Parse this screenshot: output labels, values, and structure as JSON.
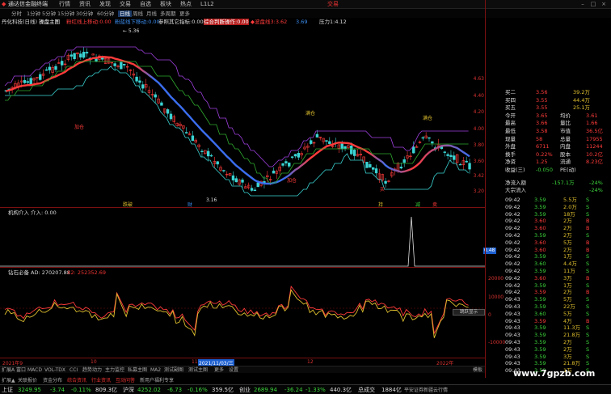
{
  "app": {
    "title": "通达信金融终端",
    "menu": [
      "行情",
      "资讯",
      "发现",
      "交易",
      "自选",
      "板块",
      "热点",
      "L1L2"
    ],
    "trade_label": "交易"
  },
  "tabs": [
    "分时",
    "1分钟",
    "5分钟",
    "15分钟",
    "30分钟",
    "60分钟",
    "日线",
    "周线",
    "月线",
    "多周期",
    "更多"
  ],
  "stock": {
    "name": "丹化科技(日线)"
  },
  "main_indicators": [
    "操盘主图",
    "粉红线上移动:0.00",
    "粉蓝线下移动:0.00",
    "参照其它指标:0.00",
    "综合判断操作:0.00",
    "◆波盘线3:3.62",
    "3.69",
    "压力1:4.12"
  ],
  "price_scale": [
    "4.63",
    "4.40",
    "4.20",
    "4.00",
    "3.80",
    "3.60",
    "3.42",
    "3.20"
  ],
  "annotations": {
    "high": "5.36",
    "low": "3.16",
    "buy": "加仓",
    "buy2": "买",
    "sell": "卖",
    "mark1": "满仓",
    "mark2": "加仓",
    "bottom_labels": [
      "跌破",
      "财",
      "持",
      "减",
      "卖"
    ]
  },
  "sub1": {
    "title": "机构介入",
    "value": "介入: 0.00",
    "scale_val": "0.48"
  },
  "sub2": {
    "title": "钻石必备",
    "ad": "AD: 270207.88",
    "x2": "X2: 252352.69",
    "scale": [
      "20000",
      "10000",
      "0",
      "-10000"
    ],
    "popup": "跳跃显示"
  },
  "xaxis": [
    "2021年9",
    "10",
    "11",
    "2021/11/03/三",
    "12",
    "2022年"
  ],
  "bottom_tabs": [
    "扩展A",
    "富口",
    "MACD",
    "VOL-TDX",
    "CCI",
    "趋势动力",
    "主力监控",
    "私募主图",
    "MA2",
    "测试副图",
    "测试主图",
    "更多",
    "设置",
    "模板"
  ],
  "aux_tabs": [
    "扩展▲",
    "关联报价",
    "资金分布",
    "综合资讯",
    "行业资讯",
    "互动问答",
    "新用户福利专享"
  ],
  "orderbook": [
    {
      "label": "买二",
      "price": "3.56",
      "vol": "39.2万"
    },
    {
      "label": "买四",
      "price": "3.55",
      "vol": "44.4万"
    },
    {
      "label": "买五",
      "price": "3.55",
      "vol": "25.1万"
    },
    {
      "label": "今开",
      "price": "3.65",
      "vol": "均价",
      "v2": "3.61"
    },
    {
      "label": "最高",
      "price": "3.66",
      "vol": "量比",
      "v2": "1.66"
    },
    {
      "label": "最低",
      "price": "3.58",
      "vol": "市值",
      "v2": "36.5亿"
    },
    {
      "label": "现量",
      "price": "58",
      "vol": "总量",
      "v2": "17955"
    },
    {
      "label": "外盘",
      "price": "6711",
      "vol": "内盘",
      "v2": "11244"
    },
    {
      "label": "换手",
      "price": "0.22%",
      "vol": "股本",
      "v2": "10.2亿"
    },
    {
      "label": "净资",
      "price": "1.25",
      "vol": "流通",
      "v2": "8.23亿"
    },
    {
      "label": "收益(三)",
      "price": "-0.050",
      "vol": "PE(动)",
      "v2": ""
    }
  ],
  "flow": [
    {
      "label": "净流入额",
      "val": "-157.1万",
      "pct": "-24%"
    },
    {
      "label": "大宗流入",
      "val": "",
      "pct": "-24%"
    }
  ],
  "trades": [
    {
      "t": "09:42",
      "p": "3.59",
      "v": "5.5万",
      "s": "S"
    },
    {
      "t": "09:42",
      "p": "3.59",
      "v": "2.0万",
      "s": "S"
    },
    {
      "t": "09:42",
      "p": "3.59",
      "v": "18万",
      "s": "S"
    },
    {
      "t": "09:42",
      "p": "3.60",
      "v": "2万",
      "s": "B"
    },
    {
      "t": "09:42",
      "p": "3.60",
      "v": "2万",
      "s": "B"
    },
    {
      "t": "09:42",
      "p": "3.59",
      "v": "2万",
      "s": "S"
    },
    {
      "t": "09:42",
      "p": "3.60",
      "v": "5万",
      "s": "B"
    },
    {
      "t": "09:42",
      "p": "3.60",
      "v": "2万",
      "s": "B"
    },
    {
      "t": "09:42",
      "p": "3.59",
      "v": "1万",
      "s": "S"
    },
    {
      "t": "09:42",
      "p": "3.60",
      "v": "4.4万",
      "s": "S"
    },
    {
      "t": "09:42",
      "p": "3.59",
      "v": "11万",
      "s": "S"
    },
    {
      "t": "09:42",
      "p": "3.60",
      "v": "3万",
      "s": "B"
    },
    {
      "t": "09:42",
      "p": "3.59",
      "v": "1万",
      "s": "S"
    },
    {
      "t": "09:42",
      "p": "3.59",
      "v": "2万",
      "s": "B"
    },
    {
      "t": "09:43",
      "p": "3.59",
      "v": "5万",
      "s": "S"
    },
    {
      "t": "09:43",
      "p": "3.59",
      "v": "22万",
      "s": "S"
    },
    {
      "t": "09:43",
      "p": "3.60",
      "v": "5万",
      "s": "S"
    },
    {
      "t": "09:43",
      "p": "3.59",
      "v": "4万",
      "s": "B"
    },
    {
      "t": "09:43",
      "p": "3.59",
      "v": "11.3万",
      "s": "S"
    },
    {
      "t": "09:43",
      "p": "3.59",
      "v": "21.8万",
      "s": "S"
    },
    {
      "t": "09:43",
      "p": "3.59",
      "v": "2万",
      "s": "S"
    },
    {
      "t": "09:43",
      "p": "3.59",
      "v": "2万",
      "s": "S"
    },
    {
      "t": "09:43",
      "p": "3.59",
      "v": "3万",
      "s": "S"
    },
    {
      "t": "09:43",
      "p": "3.59",
      "v": "21.8万",
      "s": "S"
    },
    {
      "t": "09:43",
      "p": "3.59",
      "v": "1万",
      "s": "S"
    }
  ],
  "status": [
    {
      "label": "上证",
      "val": "3249.95",
      "chg": "-3.74",
      "pct": "-0.11%",
      "amt": "809.3亿"
    },
    {
      "label": "沪深",
      "val": "4252.02",
      "chg": "-6.73",
      "pct": "-0.16%",
      "amt": "359.5亿"
    },
    {
      "label": "创业",
      "val": "2689.94",
      "chg": "-36.24",
      "pct": "-1.33%",
      "amt": "440.3亿"
    },
    {
      "label": "总成交",
      "val": "1884亿",
      "chg": "",
      "pct": "",
      "amt": ""
    }
  ],
  "status_right": "平安证券新疆云行情",
  "watermark": "www.7gpzb.com",
  "colors": {
    "up": "#ff3b3b",
    "down": "#3bd4d4",
    "bg": "#000000",
    "grid": "#7a1010"
  }
}
